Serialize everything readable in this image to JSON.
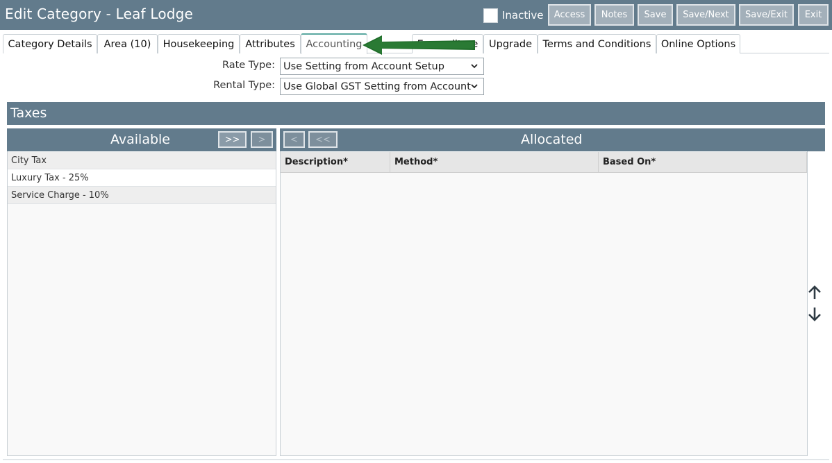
{
  "header": {
    "title": "Edit Category - Leaf Lodge",
    "inactive_label": "Inactive",
    "buttons": {
      "access": "Access",
      "notes": "Notes",
      "save": "Save",
      "save_next": "Save/Next",
      "save_exit": "Save/Exit",
      "exit": "Exit"
    }
  },
  "tabs": [
    {
      "label": "Category Details"
    },
    {
      "label": "Area (10)"
    },
    {
      "label": "Housekeeping"
    },
    {
      "label": "Attributes"
    },
    {
      "label": "Accounting",
      "active": true
    },
    {
      "label": "Expenditure"
    },
    {
      "label": "Upgrade"
    },
    {
      "label": "Terms and Conditions"
    },
    {
      "label": "Online Options"
    }
  ],
  "form": {
    "rate_type_label": "Rate Type:",
    "rate_type_value": "Use Setting from Account Setup",
    "rental_type_label": "Rental Type:",
    "rental_type_value": "Use Global GST Setting from Account"
  },
  "taxes": {
    "title": "Taxes",
    "available": {
      "title": "Available",
      "add_all_label": ">>",
      "add_label": ">",
      "items": [
        "City Tax",
        "Luxury Tax - 25%",
        "Service Charge - 10%"
      ]
    },
    "allocated": {
      "title": "Allocated",
      "remove_label": "<",
      "remove_all_label": "<<",
      "columns": [
        "Description*",
        "Method*",
        "Based On*"
      ]
    }
  },
  "colors": {
    "header_bg": "#627b8c",
    "button_bg": "#a3b0ba",
    "active_tab_accent": "#5aa8a0",
    "annotation_arrow": "#1e6b28"
  },
  "icons": {
    "move_up": "arrow-up-icon",
    "move_down": "arrow-down-icon",
    "dropdown": "chevron-down-icon"
  }
}
